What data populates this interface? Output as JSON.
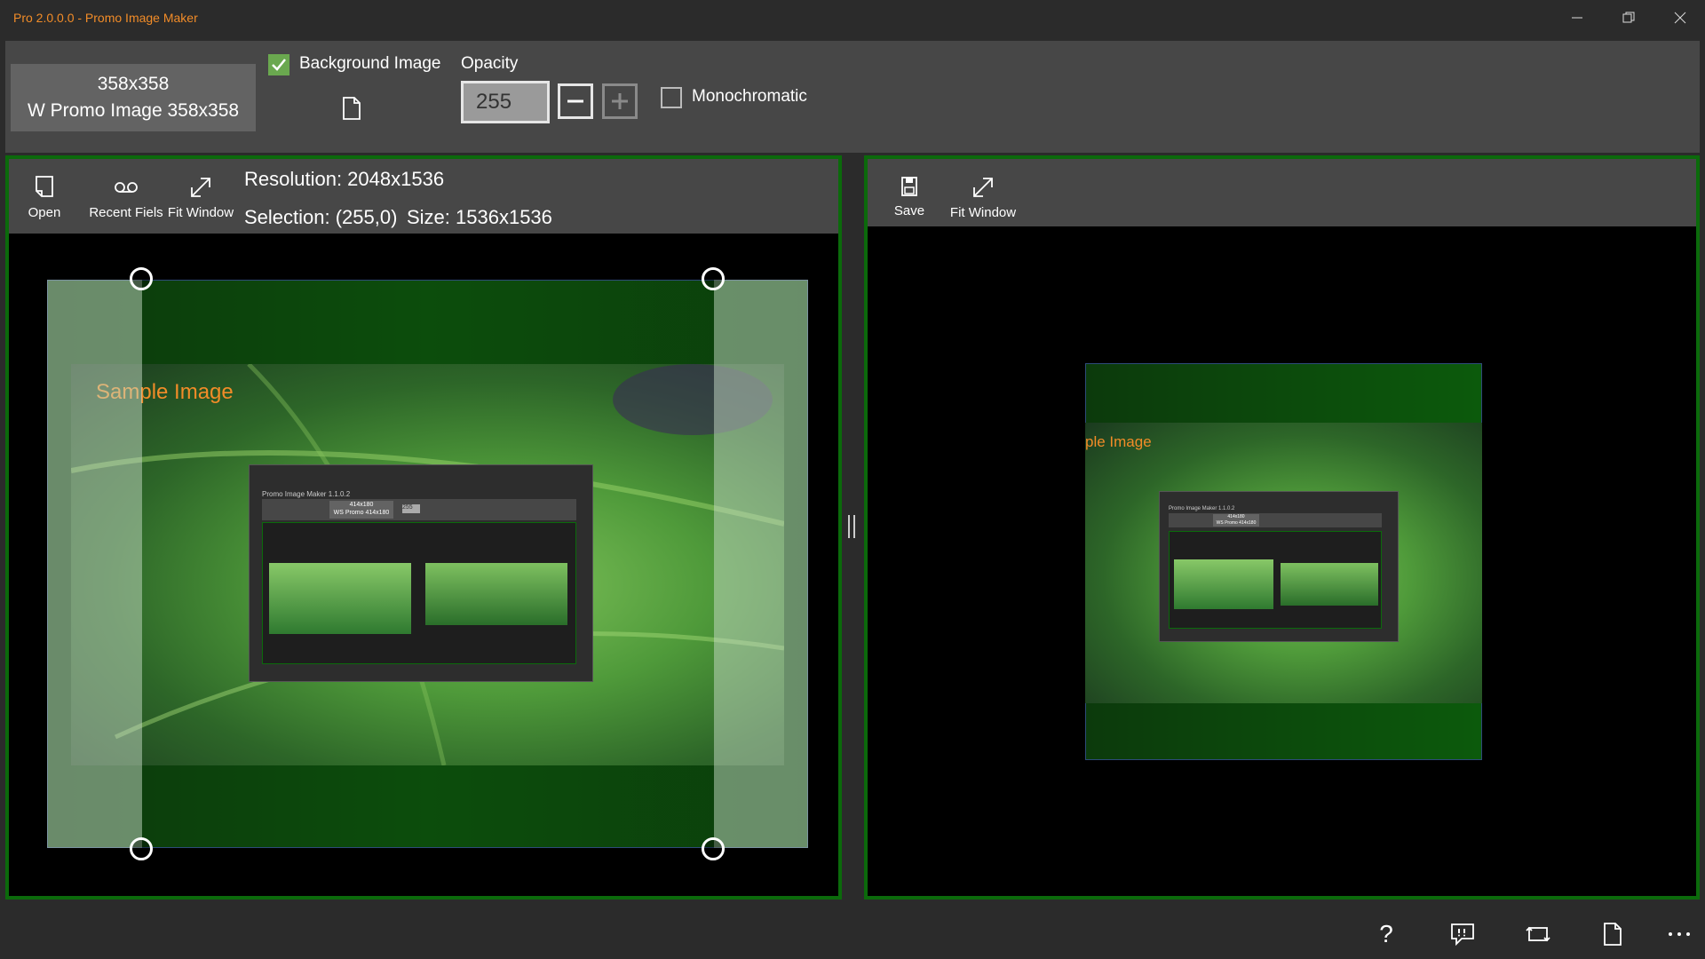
{
  "window": {
    "title": "Pro 2.0.0.0 - Promo Image Maker",
    "minimize_icon": "minimize-icon",
    "maximize_icon": "restore-icon",
    "close_icon": "close-icon"
  },
  "toolbar": {
    "preset_line1": "358x358",
    "preset_line2": "W Promo Image 358x358",
    "background_image_label": "Background Image",
    "background_image_checked": true,
    "opacity_label": "Opacity",
    "opacity_value": "255",
    "monochromatic_label": "Monochromatic",
    "monochromatic_checked": false,
    "accent_color": "#6aa84f"
  },
  "source_panel": {
    "open_label": "Open",
    "recent_label": "Recent Fiels",
    "fit_label": "Fit Window",
    "resolution_text": "Resolution: 2048x1536",
    "selection_text": "Selection: (255,0)",
    "size_text": "Size: 1536x1536",
    "sample_text": "Sample Image",
    "border_color": "#0b6a0b"
  },
  "output_panel": {
    "save_label": "Save",
    "fit_label": "Fit Window",
    "sample_text_partial": "ple Image"
  },
  "embedded_screenshot": {
    "title": "Promo Image Maker 1.1.0.2",
    "preset_line1": "414x180",
    "preset_line2": "WS Promo 414x180",
    "opacity_value": "255",
    "title_small": "Promo Image Maker 1.1.0.2",
    "preset_small_line1": "414x180",
    "preset_small_line2": "WS Promo 414x180"
  },
  "bottom_bar": {
    "help_icon": "?",
    "icons": [
      "help-icon",
      "feedback-icon",
      "crop-icon",
      "new-file-icon",
      "more-icon"
    ]
  }
}
